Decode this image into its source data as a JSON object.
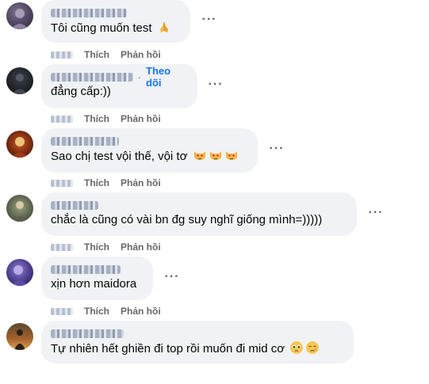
{
  "comments": [
    {
      "text": "Tôi cũng muốn test",
      "emoji": [
        "folded-hands"
      ],
      "follow": "",
      "like": "Thích",
      "reply": "Phản hồi"
    },
    {
      "text": "đẳng cấp:))",
      "emoji": [],
      "follow": "Theo dõi",
      "like": "Thích",
      "reply": "Phản hồi"
    },
    {
      "text": "Sao chị test vội thế, vội tơ",
      "emoji": [
        "heart-eyes-cat",
        "heart-eyes-cat",
        "heart-eyes-cat"
      ],
      "follow": "",
      "like": "Thích",
      "reply": "Phản hồi"
    },
    {
      "text": "chắc là cũng có vài bn đg suy nghĩ giống mình=)))))",
      "emoji": [],
      "follow": "",
      "like": "Thích",
      "reply": "Phản hồi"
    },
    {
      "text": "xịn hơn maidora",
      "emoji": [],
      "follow": "",
      "like": "Thích",
      "reply": "Phản hồi"
    },
    {
      "text": "Tự nhiên hết ghiền đi top rồi muốn đi mid cơ",
      "emoji": [
        "pleading-face",
        "crying-face"
      ],
      "follow": "",
      "like": "",
      "reply": ""
    }
  ],
  "more_label": "···",
  "colors": {
    "bubble": "#f0f2f5",
    "link": "#1877f2",
    "meta": "#65676b"
  }
}
